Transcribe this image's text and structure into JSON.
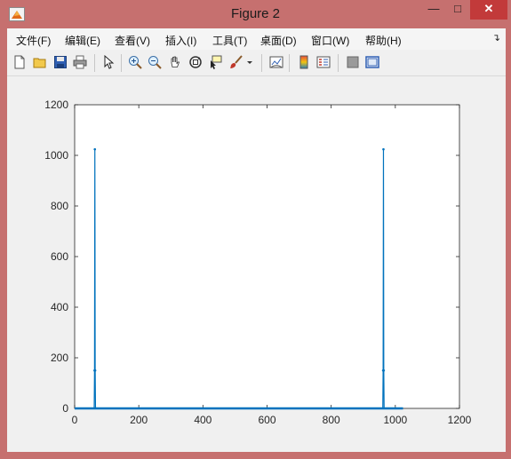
{
  "window": {
    "title": "Figure 2"
  },
  "menu": [
    "文件(F)",
    "编辑(E)",
    "查看(V)",
    "插入(I)",
    "工具(T)",
    "桌面(D)",
    "窗口(W)",
    "帮助(H)"
  ],
  "toolbar": {
    "tools": [
      "new-figure-icon",
      "open-file-icon",
      "save-icon",
      "print-icon",
      "pointer-icon",
      "zoom-in-icon",
      "zoom-out-icon",
      "pan-hand-icon",
      "rotate-3d-icon",
      "data-cursor-icon",
      "brush-icon",
      "link-plot-icon",
      "colorbar-icon",
      "legend-icon",
      "hide-plot-tools-icon",
      "show-plot-tools-icon"
    ]
  },
  "chart_data": {
    "type": "line",
    "title": "",
    "xlabel": "",
    "ylabel": "",
    "xlim": [
      0,
      1200
    ],
    "ylim": [
      0,
      1200
    ],
    "xticks": [
      0,
      200,
      400,
      600,
      800,
      1000,
      1200
    ],
    "yticks": [
      0,
      200,
      400,
      600,
      800,
      1000,
      1200
    ],
    "grid": false,
    "color": "#0072bd",
    "series": [
      {
        "x": [
          0,
          60,
          61,
          62,
          63,
          64,
          65,
          66,
          960,
          961,
          962,
          963,
          964,
          965,
          966,
          1024
        ],
        "y": [
          0,
          0,
          0,
          150,
          1024,
          150,
          0,
          0,
          0,
          0,
          150,
          1024,
          150,
          0,
          0,
          0
        ]
      }
    ]
  }
}
